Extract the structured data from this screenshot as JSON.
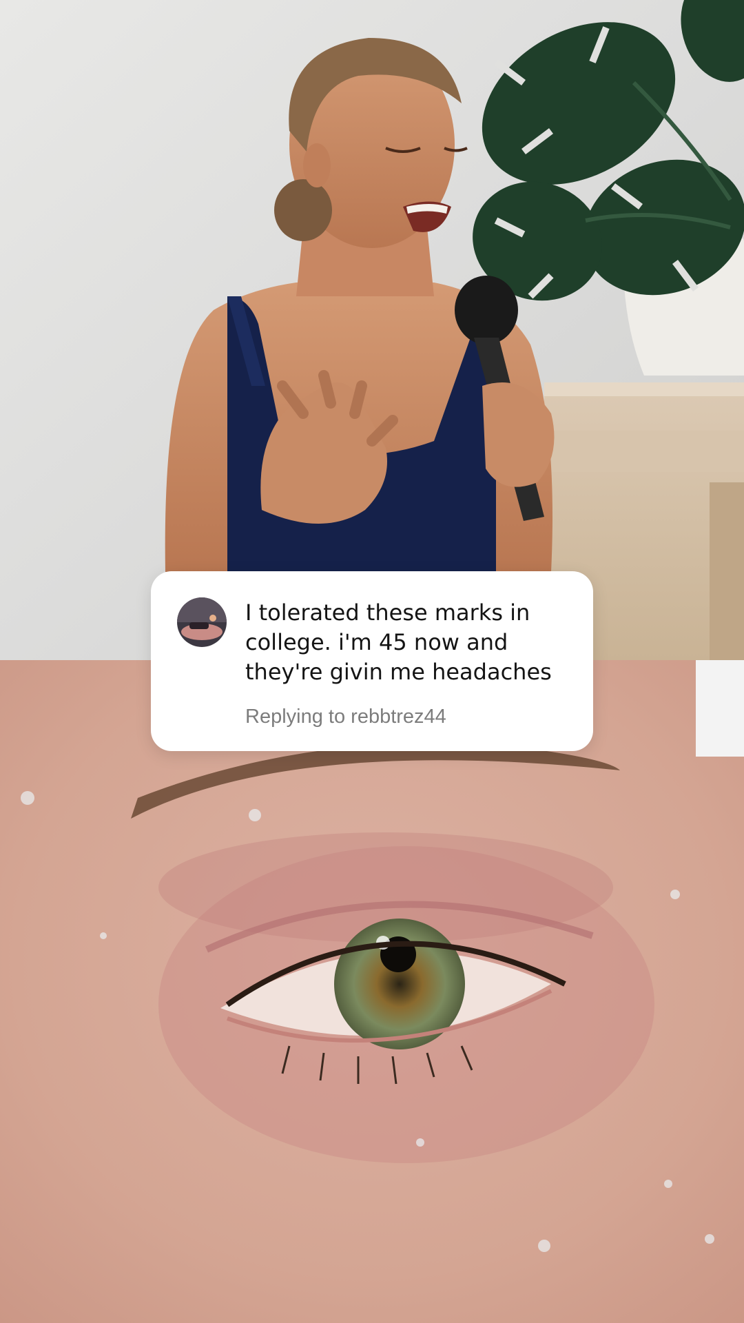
{
  "comment": {
    "text": "I tolerated these marks in\ncollege. i'm 45 now and\nthey're givin me headaches",
    "reply_prefix": "Replying to",
    "reply_username": "rebbtrez44"
  },
  "icons": {
    "avatar": "user-avatar-photo"
  },
  "colors": {
    "card_background": "#ffffff",
    "comment_text": "#141414",
    "reply_text": "#7c7c7c",
    "tank_top": "#15214a",
    "wall": "#dcdcdc"
  }
}
